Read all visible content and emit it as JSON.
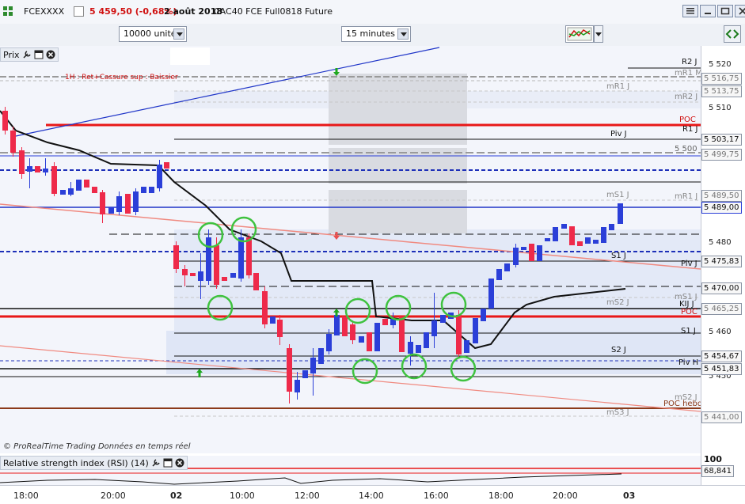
{
  "topbar": {
    "symbol": "FCEXXXX",
    "price_change": "5 459,50 (-0,68%)",
    "date": "2 août 2018",
    "description": "CAC40 FCE Full0818 Future"
  },
  "toolbar": {
    "units": "10000 unités",
    "timeframe": "15 minutes"
  },
  "price_pane": {
    "title": "Prix",
    "indicator_note": "1H : Ret+Cassure sup : Baissier",
    "credit": "© ProRealTime Trading  Données en temps réel"
  },
  "rsi_pane": {
    "title": "Relative strength index (RSI) (14)",
    "level_label": "100",
    "value": "68,841"
  },
  "price_axis": {
    "ticks": [
      "5 520",
      "5 510",
      "5 480",
      "5 460",
      "5 450"
    ],
    "tags": [
      "5 516,75",
      "5 513,75",
      "5 503,17",
      "5 499,75",
      "5 489,50",
      "5 489,00",
      "5 475,83",
      "5 470,00",
      "5 465,25",
      "5 454,67",
      "5 451,83",
      "5 441,00"
    ]
  },
  "level_labels": [
    "R2 J",
    "mR1 M",
    "mR1 J",
    "mR2 J",
    "POC",
    "R1 J",
    "Piv J",
    "5 500",
    "mS1 J",
    "mR1 J",
    "S1 J",
    "Piv J",
    "mS1 J",
    "mS2 J",
    "KIJ J",
    "POC",
    "S1 J",
    "S2 J",
    "Piv H",
    "mS2 J",
    "POC hebdo",
    "mS3 J"
  ],
  "time_axis": [
    "18:00",
    "20:00",
    "02",
    "10:00",
    "12:00",
    "14:00",
    "16:00",
    "18:00",
    "20:00",
    "03"
  ],
  "colors": {
    "bull_candle": "#2b3fd8",
    "bear_candle": "#ee2a4a",
    "poc_line": "#e81818",
    "trend_line": "#1f35c8",
    "highlight_circle": "#3fc23f"
  }
}
